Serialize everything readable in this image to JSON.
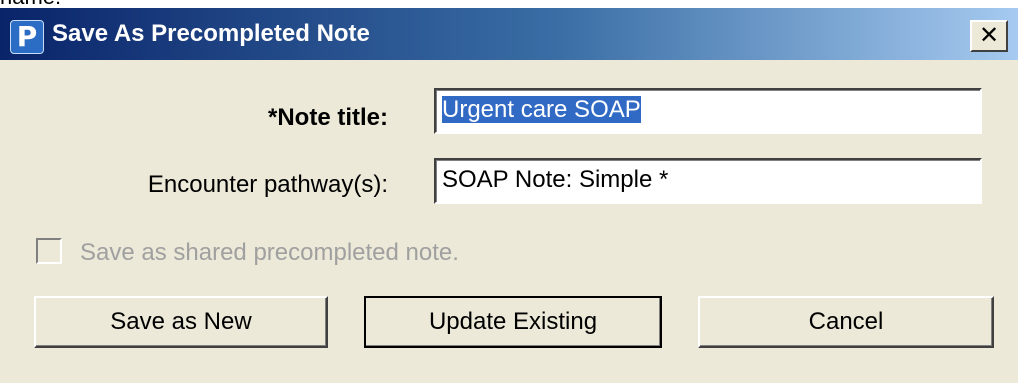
{
  "window": {
    "title": "Save As Precompleted Note",
    "app_icon_letter": "P",
    "close_glyph": "✕",
    "top_clipped_text": "name:"
  },
  "form": {
    "note_title": {
      "label": "*Note title:",
      "value": "Urgent care SOAP"
    },
    "encounter_pathway": {
      "label": "Encounter pathway(s):",
      "value": "SOAP Note: Simple *"
    },
    "shared_checkbox": {
      "label": "Save as shared precompleted note.",
      "checked": false,
      "disabled": true
    }
  },
  "buttons": {
    "save_as_new": "Save as New",
    "update_existing": "Update Existing",
    "cancel": "Cancel"
  },
  "colors": {
    "titlebar_start": "#0a246a",
    "titlebar_end": "#a6caf0",
    "selection": "#316ac5",
    "dialog_bg": "#ece9d8"
  },
  "icons": {
    "app": "p-app-icon",
    "close": "close-icon"
  }
}
